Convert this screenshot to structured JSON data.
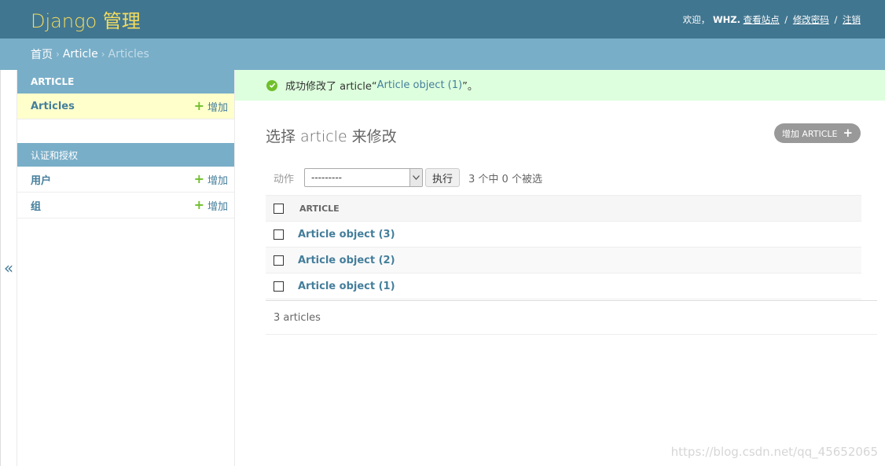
{
  "header": {
    "site_name": "Django 管理",
    "welcome": "欢迎，",
    "username": "WHZ.",
    "view_site": "查看站点",
    "change_password": "修改密码",
    "logout": "注销",
    "sep": "/"
  },
  "breadcrumbs": {
    "home": "首页",
    "app": "Article",
    "current": "Articles",
    "arrow": "›"
  },
  "nav_toggle": "«",
  "sidebar": {
    "modules": [
      {
        "caption": "ARTICLE",
        "models": [
          {
            "name": "Articles",
            "add": "增加"
          }
        ]
      },
      {
        "caption": "认证和授权",
        "models": [
          {
            "name": "用户",
            "add": "增加"
          },
          {
            "name": "组",
            "add": "增加"
          }
        ]
      }
    ]
  },
  "message": {
    "prefix": "成功修改了 article“",
    "link": "Article object (1)",
    "suffix": "”。"
  },
  "content": {
    "title": "选择 article 来修改",
    "add_button": "增加 ARTICLE",
    "add_plus": "+",
    "actions_label": "动作",
    "action_selected": "---------",
    "go_button": "执行",
    "counter": "3 个中 0 个被选",
    "column_header": "ARTICLE",
    "rows": [
      "Article object (3)",
      "Article object (2)",
      "Article object (1)"
    ],
    "paginator": "3 articles"
  },
  "watermark": "https://blog.csdn.net/qq_45652065",
  "colors": {
    "header": "#417690",
    "branding": "#f5dd5d",
    "breadcrumbs": "#79aec8",
    "link": "#447e9b",
    "add_plus": "#70bf2b",
    "selected_row": "#ffffcc",
    "success": "#ddffdd"
  }
}
